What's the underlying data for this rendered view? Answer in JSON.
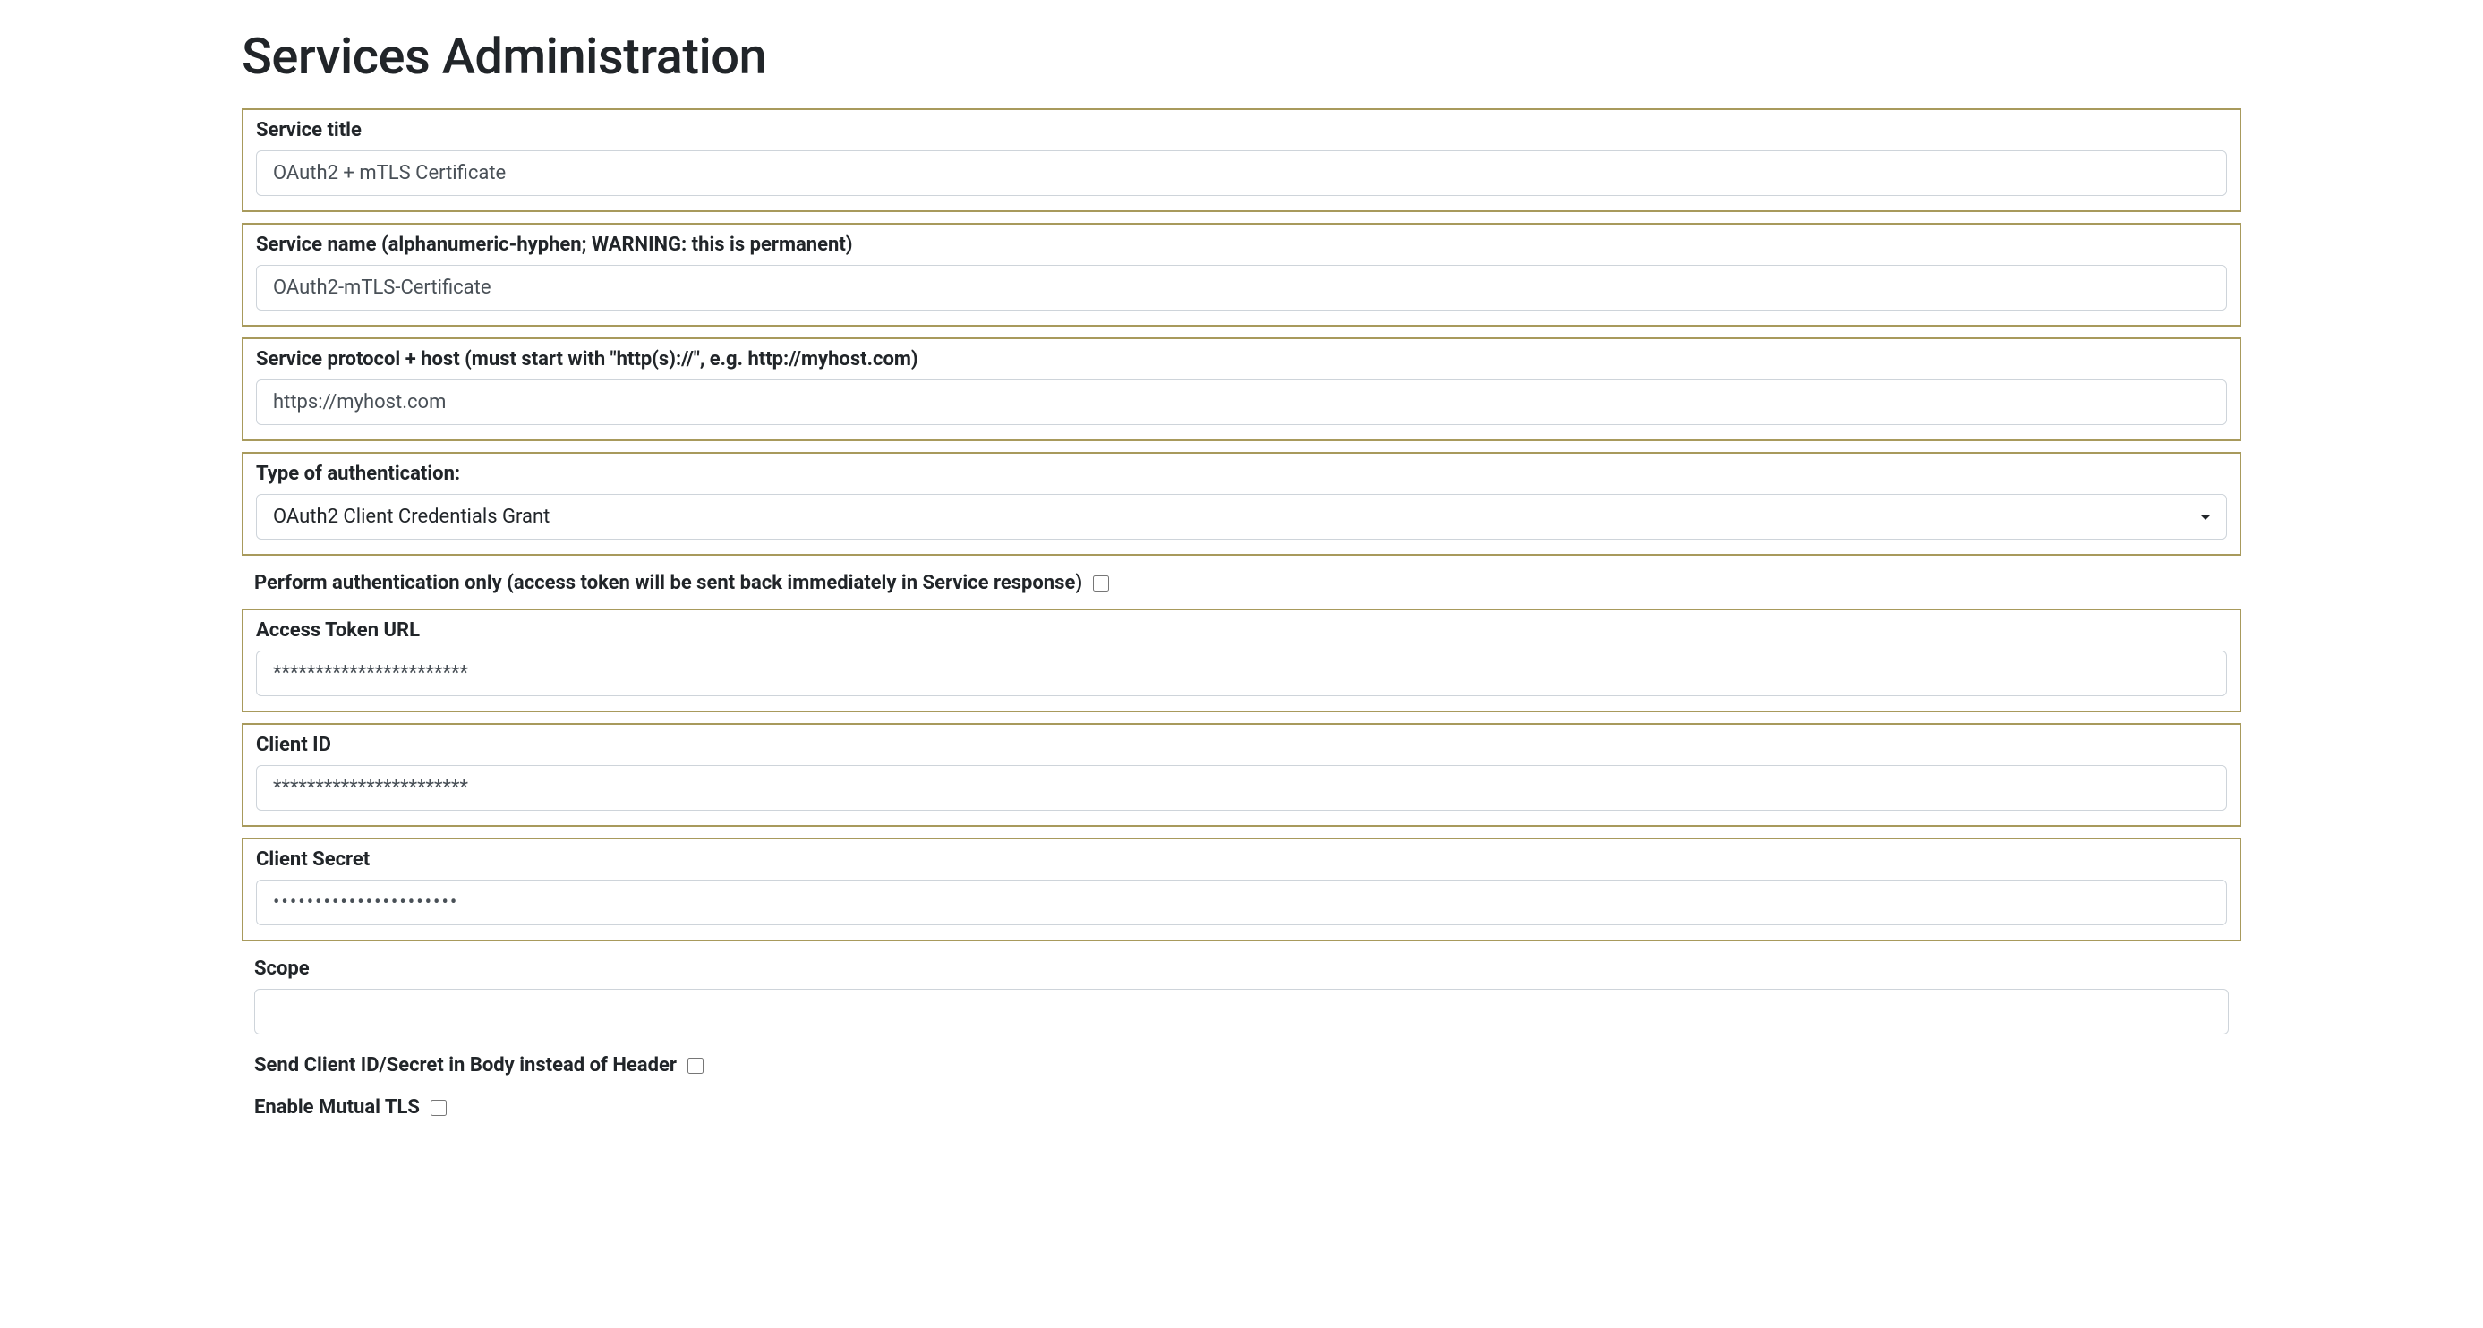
{
  "page": {
    "title": "Services Administration"
  },
  "fields": {
    "service_title": {
      "label": "Service title",
      "value": "OAuth2 + mTLS Certificate"
    },
    "service_name": {
      "label": "Service name (alphanumeric-hyphen; WARNING: this is permanent)",
      "value": "OAuth2-mTLS-Certificate"
    },
    "service_host": {
      "label": "Service protocol + host (must start with \"http(s)://\", e.g. http://myhost.com)",
      "value": "https://myhost.com"
    },
    "auth_type": {
      "label": "Type of authentication:",
      "selected": "OAuth2 Client Credentials Grant"
    },
    "perform_auth_only": {
      "label": "Perform authentication only (access token will be sent back immediately in Service response)",
      "checked": false
    },
    "access_token_url": {
      "label": "Access Token URL",
      "value": "***********************"
    },
    "client_id": {
      "label": "Client ID",
      "value": "***********************"
    },
    "client_secret": {
      "label": "Client Secret",
      "value": "••••••••••••••••••••••"
    },
    "scope": {
      "label": "Scope",
      "value": ""
    },
    "send_in_body": {
      "label": "Send Client ID/Secret in Body instead of Header",
      "checked": false
    },
    "enable_mtls": {
      "label": "Enable Mutual TLS",
      "checked": false
    }
  }
}
